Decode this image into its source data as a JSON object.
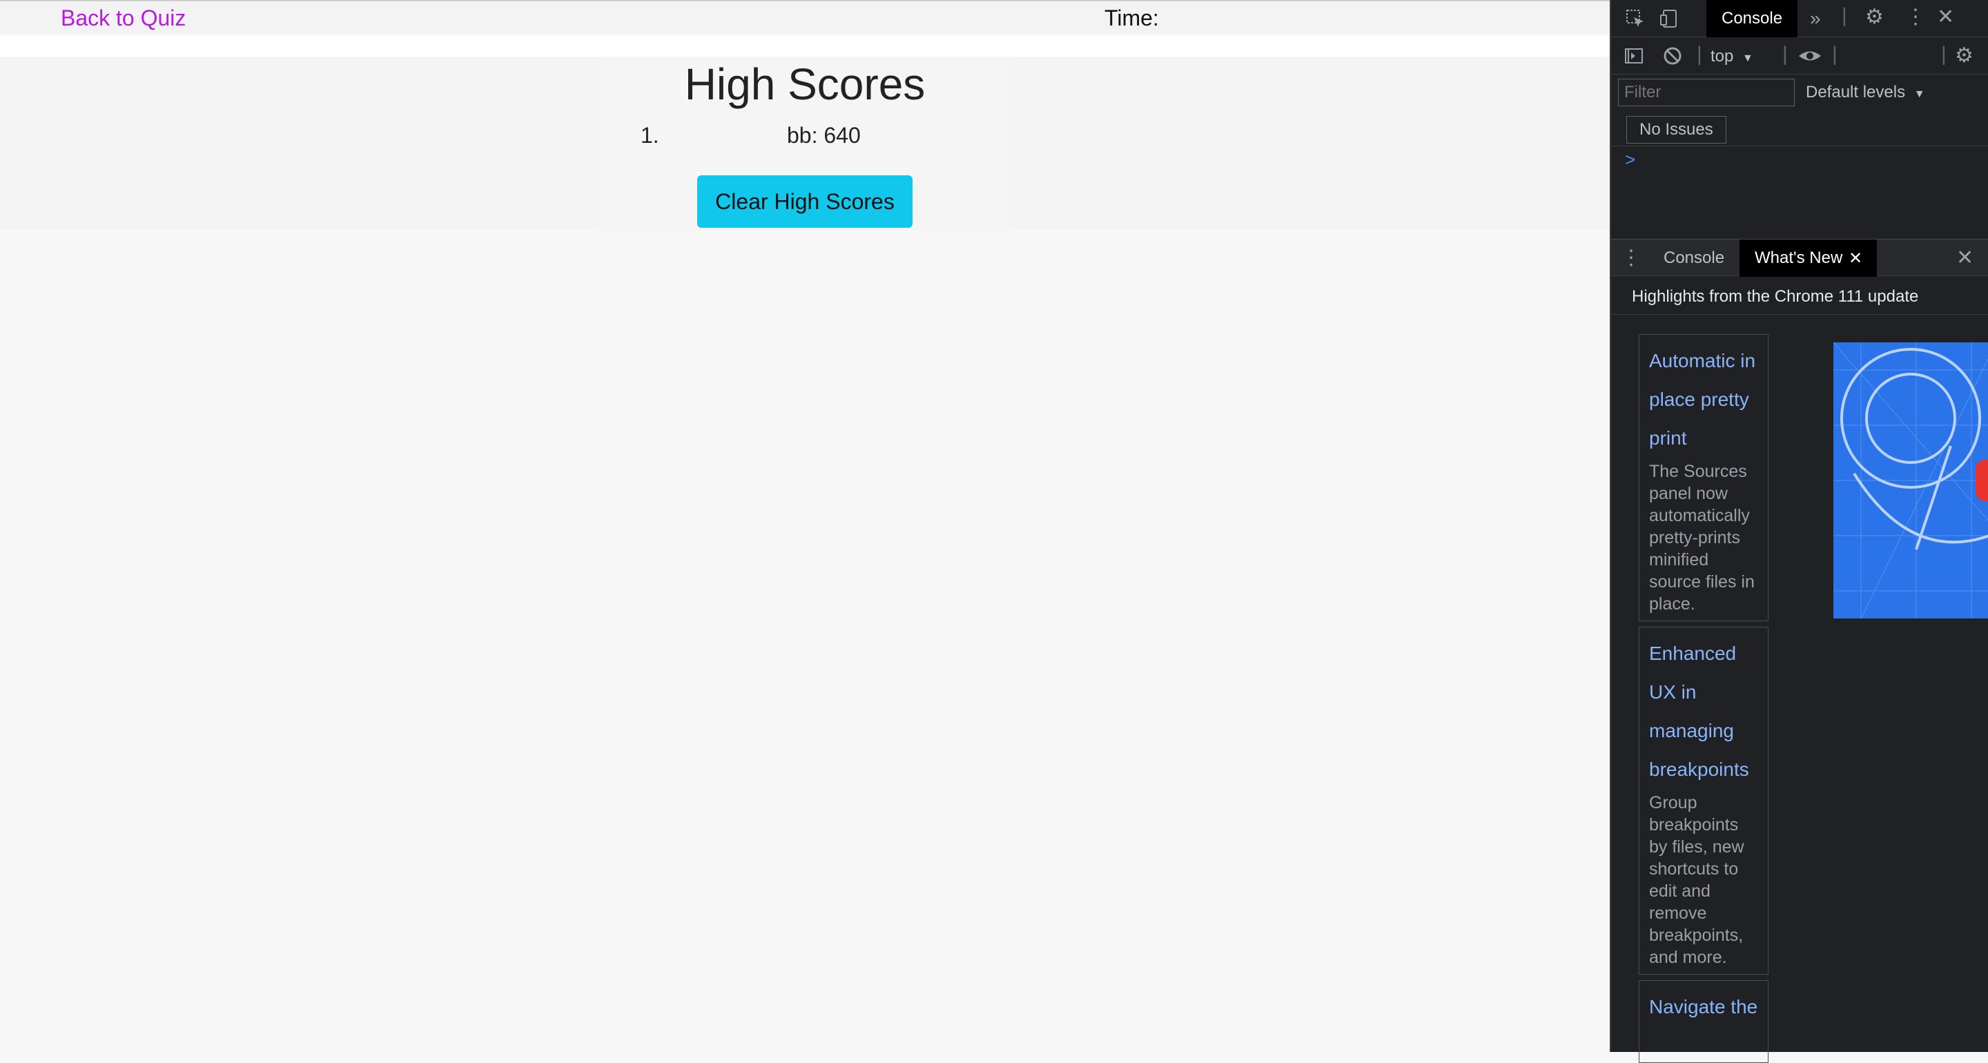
{
  "page": {
    "back_link": "Back to Quiz",
    "time_label": "Time:",
    "title": "High Scores",
    "scores": [
      {
        "rank": "1.",
        "entry": "bb: 640"
      }
    ],
    "clear_button": "Clear High Scores",
    "colors": {
      "link": "#b619e0",
      "button": "#12c7ec"
    }
  },
  "devtools": {
    "main_tabs": [
      "Console"
    ],
    "more_tabs_icon": "chevron-double-right-icon",
    "context": "top",
    "filter_placeholder": "Filter",
    "levels": "Default levels",
    "issues": "No Issues",
    "prompt": ">",
    "drawer_tabs": [
      "Console",
      "What's New"
    ],
    "highlight": "Highlights from the Chrome 111 update",
    "features": [
      {
        "title": "Automatic in place pretty print",
        "desc": "The Sources panel now automatically pretty-prints minified source files in place."
      },
      {
        "title": "Enhanced UX in managing breakpoints",
        "desc": "Group breakpoints by files, new shortcuts to edit and remove breakpoints, and more."
      },
      {
        "title": "Navigate the",
        "desc": ""
      }
    ]
  }
}
